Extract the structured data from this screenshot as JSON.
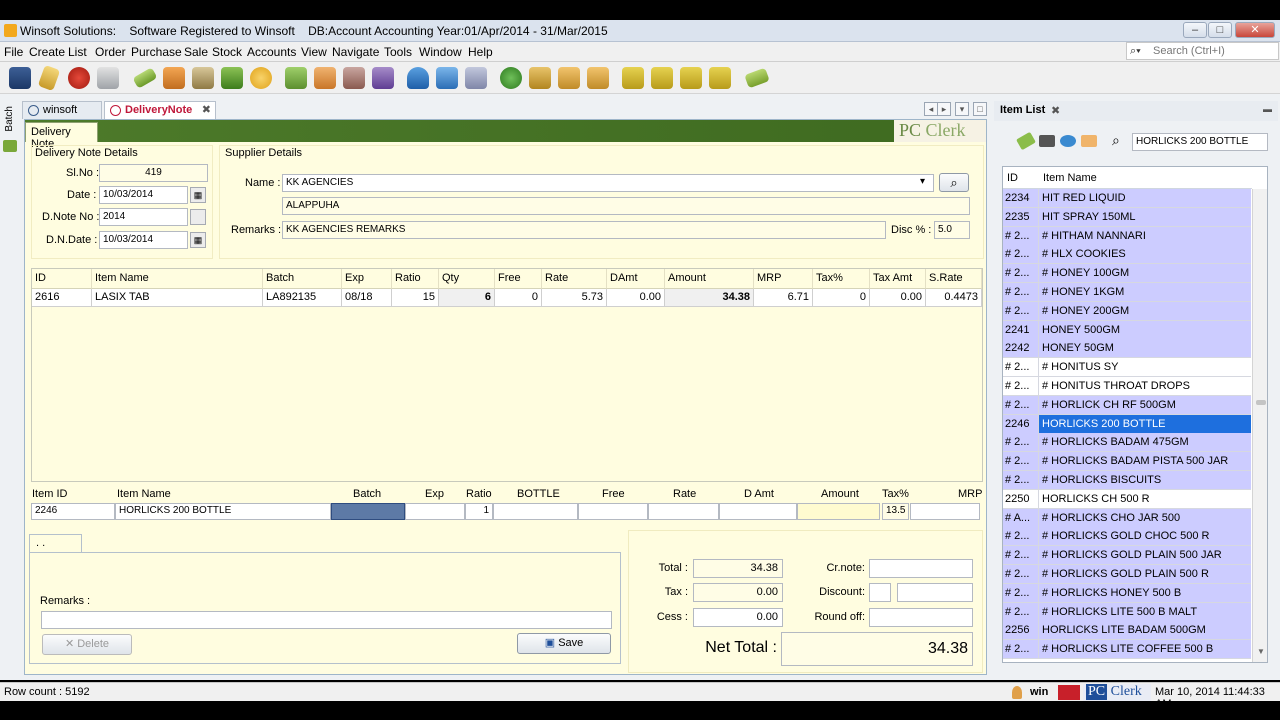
{
  "window": {
    "title": "Winsoft Solutions:    Software Registered to Winsoft    DB:Account Accounting Year:01/Apr/2014 - 31/Mar/2015",
    "minimize": "–",
    "restore": "□",
    "close": "✕"
  },
  "menu": [
    "File",
    "Create",
    "List",
    "Order",
    "Purchase",
    "Sale",
    "Stock",
    "Accounts",
    "View",
    "Navigate",
    "Tools",
    "Window",
    "Help"
  ],
  "search": {
    "icon": "search-icon",
    "glyph": "⌕▾",
    "placeholder": "Search (Ctrl+I)"
  },
  "sidebar": {
    "batch_label": "Batch"
  },
  "tabs": [
    {
      "label": "winsoft",
      "close": ""
    },
    {
      "label": "DeliveryNote",
      "close": "✖"
    }
  ],
  "nav": {
    "prev": "◂",
    "next": "▸",
    "menu": "▾",
    "max": "□"
  },
  "panel": {
    "tab_label": "Delivery Note",
    "brand_pc": "PC",
    "brand_clerk": "Clerk"
  },
  "delivery_details": {
    "group_label": "Delivery Note Details",
    "slno_label": "Sl.No :",
    "slno": "419",
    "date_label": "Date :",
    "date": "10/03/2014",
    "dnote_no_label": "D.Note No :",
    "dnote_no": "2014",
    "dn_date_label": "D.N.Date :",
    "dn_date": "10/03/2014",
    "cal_glyph": "▦"
  },
  "supplier": {
    "group_label": "Supplier Details",
    "name_label": "Name :",
    "name": "KK AGENCIES",
    "address": "ALAPPUHA",
    "remarks_label": "Remarks :",
    "remarks": "KK AGENCIES REMARKS",
    "disc_label": "Disc % :",
    "disc": "5.0",
    "dropdown_glyph": "▾",
    "search_glyph": "⌕"
  },
  "grid": {
    "columns": [
      "ID",
      "Item Name",
      "Batch",
      "Exp",
      "Ratio",
      "Qty",
      "Free",
      "Rate",
      "DAmt",
      "Amount",
      "MRP",
      "Tax%",
      "Tax Amt",
      "S.Rate"
    ],
    "rows": [
      [
        "2616",
        "LASIX TAB",
        "LA892135",
        "08/18",
        "15",
        "6",
        "0",
        "5.73",
        "0.00",
        "34.38",
        "6.71",
        "0",
        "0.00",
        "0.4473"
      ]
    ]
  },
  "entry": {
    "headers": [
      "Item ID",
      "Item Name",
      "Batch",
      "Exp",
      "Ratio",
      "BOTTLE",
      "Free",
      "Rate",
      "D Amt",
      "Amount",
      "Tax%",
      "MRP"
    ],
    "values": {
      "item_id": "2246",
      "item_name": "HORLICKS 200 BOTTLE",
      "batch": "",
      "exp": "",
      "ratio": "1",
      "bottle": "",
      "free": "",
      "rate": "",
      "damt": "",
      "amount": "",
      "tax": "13.5",
      "mrp": ""
    }
  },
  "bottom": {
    "tab_label": ".       .",
    "remarks_label": "Remarks :",
    "delete_label": "Delete",
    "delete_glyph": "✕",
    "save_label": "Save",
    "save_glyph": "▣"
  },
  "totals": {
    "total_label": "Total :",
    "total": "34.38",
    "tax_label": "Tax :",
    "tax": "0.00",
    "cess_label": "Cess :",
    "cess": "0.00",
    "crnote_label": "Cr.note:",
    "crnote": "",
    "discount_label": "Discount:",
    "discount": "",
    "roundoff_label": "Round off:",
    "roundoff": "",
    "net_label": "Net Total :",
    "net": "34.38"
  },
  "item_list": {
    "title": "Item List",
    "close": "✖",
    "min": "▬",
    "search_value": "HORLICKS 200 BOTTLE",
    "search_glyph": "⌕",
    "columns": [
      "ID",
      "Item Name"
    ],
    "items": [
      {
        "id": "2234",
        "name": "HIT RED LIQUID",
        "alt": true
      },
      {
        "id": "2235",
        "name": "HIT SPRAY 150ML",
        "alt": true
      },
      {
        "id": "# 2...",
        "name": "# HITHAM NANNARI",
        "alt": true
      },
      {
        "id": "# 2...",
        "name": "# HLX COOKIES",
        "alt": true
      },
      {
        "id": "# 2...",
        "name": "# HONEY 100GM",
        "alt": true
      },
      {
        "id": "# 2...",
        "name": "# HONEY 1KGM",
        "alt": true
      },
      {
        "id": "# 2...",
        "name": "# HONEY 200GM",
        "alt": true
      },
      {
        "id": "2241",
        "name": "HONEY 500GM",
        "alt": true
      },
      {
        "id": "2242",
        "name": "HONEY 50GM",
        "alt": true
      },
      {
        "id": "# 2...",
        "name": "# HONITUS SY",
        "alt": false
      },
      {
        "id": "# 2...",
        "name": "# HONITUS THROAT DROPS",
        "alt": false
      },
      {
        "id": "# 2...",
        "name": "# HORLICK CH RF 500GM",
        "alt": true
      },
      {
        "id": "2246",
        "name": "HORLICKS 200 BOTTLE",
        "alt": true,
        "selected": true
      },
      {
        "id": "# 2...",
        "name": "# HORLICKS BADAM 475GM",
        "alt": true
      },
      {
        "id": "# 2...",
        "name": "# HORLICKS BADAM PISTA 500 JAR",
        "alt": true
      },
      {
        "id": "# 2...",
        "name": "# HORLICKS BISCUITS",
        "alt": true
      },
      {
        "id": "2250",
        "name": "HORLICKS CH 500 R",
        "alt": false
      },
      {
        "id": "# A...",
        "name": "# HORLICKS CHO JAR 500",
        "alt": true
      },
      {
        "id": "# 2...",
        "name": "# HORLICKS GOLD CHOC 500 R",
        "alt": true
      },
      {
        "id": "# 2...",
        "name": "# HORLICKS GOLD PLAIN 500 JAR",
        "alt": true
      },
      {
        "id": "# 2...",
        "name": "# HORLICKS GOLD PLAIN 500 R",
        "alt": true
      },
      {
        "id": "# 2...",
        "name": "# HORLICKS HONEY  500 B",
        "alt": true
      },
      {
        "id": "# 2...",
        "name": "# HORLICKS LITE 500 B MALT",
        "alt": true
      },
      {
        "id": "2256",
        "name": "HORLICKS LITE BADAM 500GM",
        "alt": true
      },
      {
        "id": "# 2...",
        "name": "# HORLICKS LITE COFFEE 500 B",
        "alt": true
      }
    ]
  },
  "status": {
    "row_count": "Row count : 5192",
    "user": "win",
    "brand_pc": "PC",
    "brand_clerk": "Clerk",
    "datetime": "Mar 10, 2014 11:44:33 AM"
  },
  "colors": {
    "accent_green": "#4d7a2a",
    "selection_blue": "#1e6fde",
    "list_alt": "#ccccff",
    "panel_bg": "#fffde0"
  }
}
